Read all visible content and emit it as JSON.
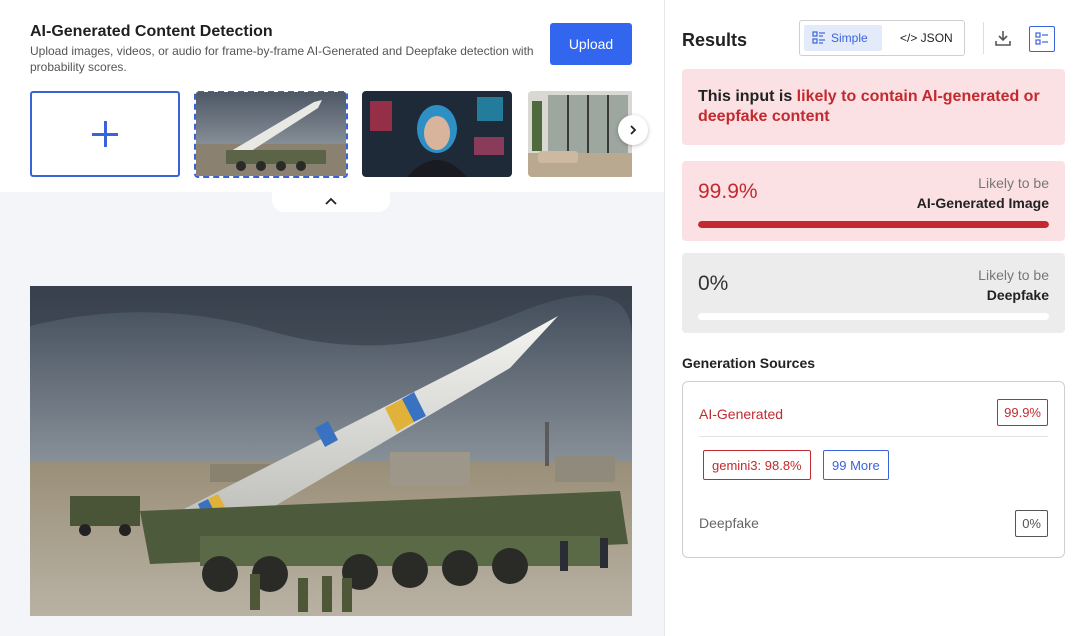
{
  "header": {
    "title": "AI-Generated Content Detection",
    "subtitle": "Upload images, videos, or audio for frame-by-frame AI-Generated and Deepfake detection with probability scores.",
    "upload_label": "Upload"
  },
  "thumbnails": [
    {
      "name": "missile-launcher",
      "selected": true
    },
    {
      "name": "neon-portrait",
      "selected": false
    },
    {
      "name": "living-room",
      "selected": false
    }
  ],
  "results": {
    "title": "Results",
    "toggle": {
      "simple_label": "Simple",
      "json_label": "</> JSON",
      "active": "Simple"
    },
    "verdict": {
      "prefix": "This input is ",
      "highlight": "likely to contain AI-generated or deepfake content"
    },
    "ai_card": {
      "percent_text": "99.9%",
      "fraction": 0.999,
      "label_top": "Likely to be",
      "label_bottom": "AI-Generated Image"
    },
    "deepfake_card": {
      "percent_text": "0%",
      "fraction": 0,
      "label_top": "Likely to be",
      "label_bottom": "Deepfake"
    },
    "sources": {
      "title": "Generation Sources",
      "ai_label": "AI-Generated",
      "ai_value": "99.9%",
      "model_chip": "gemini3: 98.8%",
      "more_chip": "99 More",
      "deepfake_label": "Deepfake",
      "deepfake_value": "0%"
    }
  },
  "colors": {
    "accent": "#3366ee",
    "danger": "#c22a2f",
    "danger_bg": "#fbe1e3",
    "neutral_bg": "#ececec"
  }
}
